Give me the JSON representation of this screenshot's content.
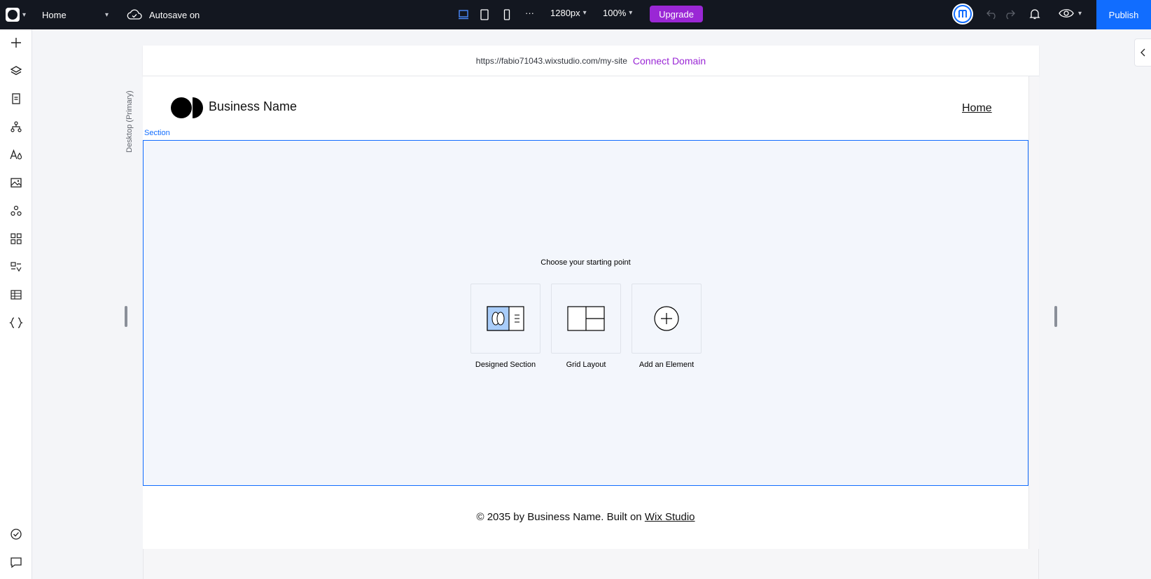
{
  "topbar": {
    "page_name": "Home",
    "autosave": "Autosave on",
    "more": "···",
    "width_value": "1280px",
    "zoom_value": "100%",
    "upgrade_label": "Upgrade",
    "publish_label": "Publish"
  },
  "canvas": {
    "url": "https://fabio71043.wixstudio.com/my-site",
    "connect_domain": "Connect Domain",
    "breakpoint_label": "Desktop (Primary)",
    "section_label": "Section"
  },
  "site": {
    "business_name": "Business Name",
    "nav_home": "Home",
    "footer_prefix": "© 2035 by Business Name. Built on ",
    "footer_link": "Wix Studio"
  },
  "empty_section": {
    "title": "Choose your starting point",
    "options": [
      {
        "label": "Designed Section",
        "icon": "designed-section-icon"
      },
      {
        "label": "Grid Layout",
        "icon": "grid-layout-icon"
      },
      {
        "label": "Add an Element",
        "icon": "add-element-icon"
      }
    ]
  },
  "left_toolbar": [
    {
      "icon": "add-icon"
    },
    {
      "icon": "layers-icon"
    },
    {
      "icon": "pages-icon"
    },
    {
      "icon": "site-structure-icon"
    },
    {
      "icon": "design-icon"
    },
    {
      "icon": "media-icon"
    },
    {
      "icon": "apps-icon"
    },
    {
      "icon": "widgets-icon"
    },
    {
      "icon": "business-icon"
    },
    {
      "icon": "cms-icon"
    },
    {
      "icon": "code-icon"
    },
    {
      "icon": "site-checklist-icon"
    },
    {
      "icon": "comments-icon"
    }
  ],
  "colors": {
    "topbar_bg": "#131720",
    "accent_blue": "#116dff",
    "upgrade_purple": "#9a27d5",
    "section_bg": "#f3f6fc"
  }
}
